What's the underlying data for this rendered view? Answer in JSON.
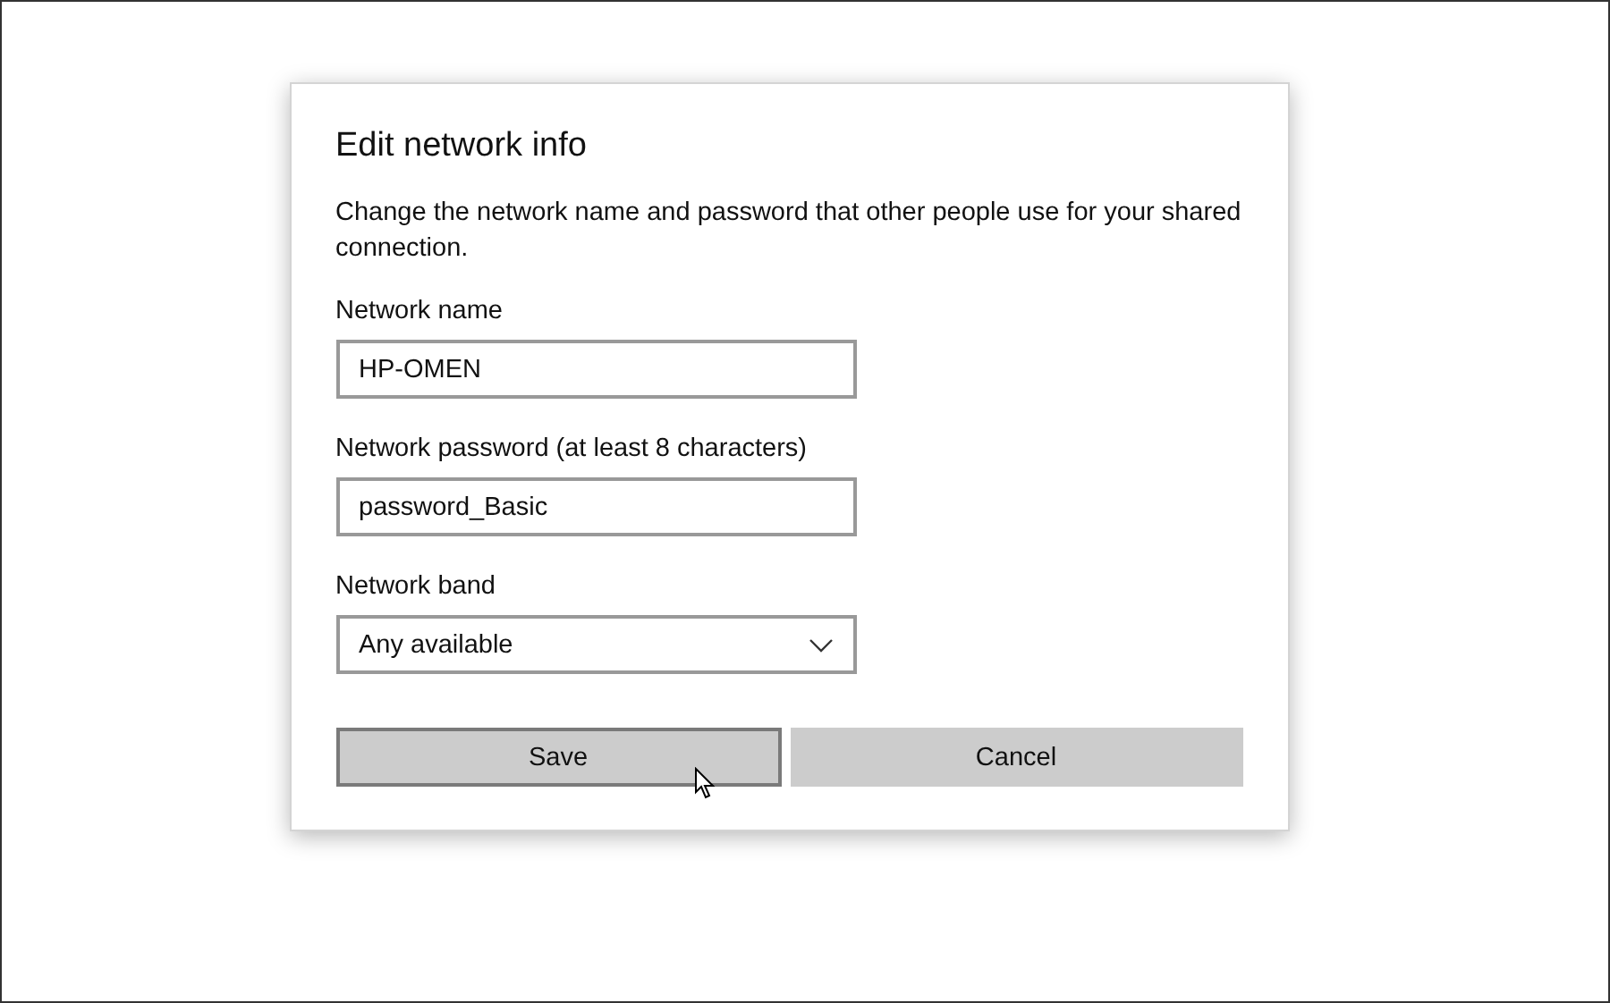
{
  "dialog": {
    "title": "Edit network info",
    "description": "Change the network name and password that other people use for your shared connection.",
    "fields": [
      {
        "kind": "text",
        "label": "Network name",
        "value": "HP-OMEN"
      },
      {
        "kind": "text",
        "label": "Network password (at least 8 characters)",
        "value": "password_Basic"
      },
      {
        "kind": "dropdown",
        "label": "Network band",
        "value": "Any available"
      }
    ],
    "buttons": [
      {
        "label": "Save",
        "focused": true
      },
      {
        "label": "Cancel",
        "focused": false
      }
    ]
  }
}
